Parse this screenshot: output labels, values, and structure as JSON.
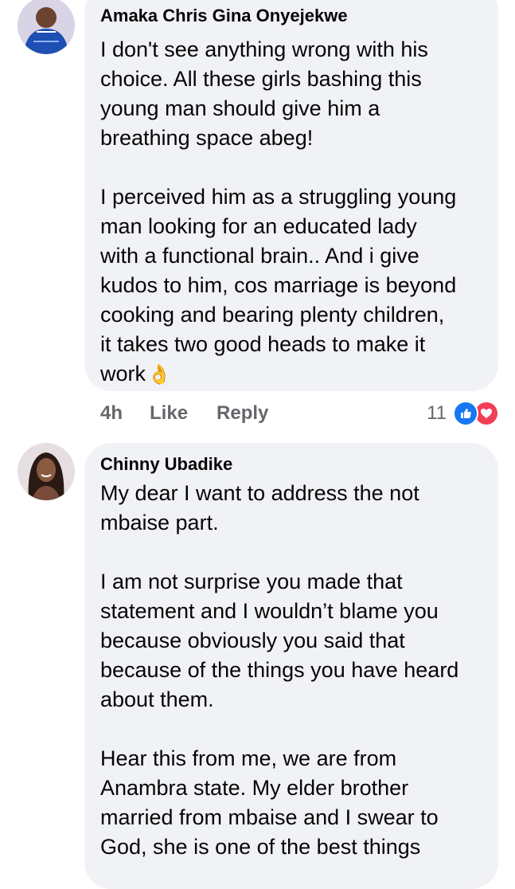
{
  "comments": [
    {
      "author": "Amaka Chris Gina Onyejekwe",
      "avatar": "woman-in-blue-lace-avatar",
      "paragraphs": [
        [
          "I don't see anything wrong with his",
          "choice. All these girls bashing this",
          "young man should give him a",
          "breathing space abeg!"
        ],
        [
          "I perceived him as a struggling young",
          "man looking for an educated lady",
          "with a functional brain.. And i give",
          "kudos to him, cos marriage is beyond",
          "cooking and bearing plenty children,",
          "it takes two good heads to make it",
          "work"
        ]
      ],
      "trailing_emoji": "👌",
      "time": "4h",
      "like_label": "Like",
      "reply_label": "Reply",
      "reaction_count": "11",
      "reaction_icons": [
        "like-icon",
        "love-icon"
      ]
    },
    {
      "author": "Chinny Ubadike",
      "avatar": "woman-smiling-avatar",
      "paragraphs": [
        [
          "My dear I want to address the not",
          "mbaise part."
        ],
        [
          "I am not surprise you made that",
          "statement and I wouldn’t blame you",
          "because obviously you said that",
          "because of the things you have heard",
          "about them."
        ],
        [
          "Hear this from me,  we are from",
          "Anambra state.  My elder brother",
          "married from mbaise and I swear to",
          "God, she is one of the best things"
        ]
      ]
    }
  ],
  "colors": {
    "bubble": "#f0f2f5",
    "meta_text": "#65676b",
    "like_blue": "#1877f2",
    "love_red": "#f33e58"
  }
}
